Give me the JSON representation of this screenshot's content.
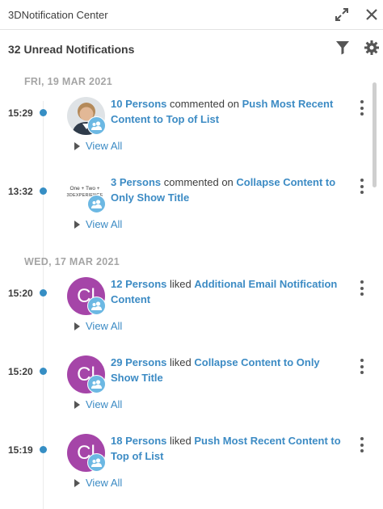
{
  "header": {
    "title": "3DNotification Center",
    "expand_icon": "expand-icon",
    "close_icon": "close-icon"
  },
  "subheader": {
    "unread_label": "32 Unread Notifications",
    "filter_icon": "filter-icon",
    "settings_icon": "gear-icon"
  },
  "colors": {
    "accent": "#3c8bc4",
    "avatar_purple": "#a545a8",
    "badge_blue": "#6cb8e3",
    "date_gray": "#a5a5a5"
  },
  "groups": [
    {
      "date": "FRI, 19 MAR 2021",
      "items": [
        {
          "time": "15:29",
          "avatar_type": "photo",
          "actor": "10 Persons",
          "verb": "commented on",
          "target": "Push Most Recent Content to Top of List",
          "view_all": "View All"
        },
        {
          "time": "13:32",
          "avatar_type": "logo",
          "logo_line1": "One + Two +",
          "logo_line2": "3DEXPERIENCE",
          "actor": "3 Persons",
          "verb": "commented on",
          "target": "Collapse Content to Only Show Title",
          "view_all": "View All"
        }
      ]
    },
    {
      "date": "WED, 17 MAR 2021",
      "items": [
        {
          "time": "15:20",
          "avatar_type": "initials",
          "initials": "Cl",
          "actor": "12 Persons",
          "verb": "liked",
          "target": "Additional Email Notification Content",
          "view_all": "View All"
        },
        {
          "time": "15:20",
          "avatar_type": "initials",
          "initials": "Cl",
          "actor": "29 Persons",
          "verb": "liked",
          "target": "Collapse Content to Only Show Title",
          "view_all": "View All"
        },
        {
          "time": "15:19",
          "avatar_type": "initials",
          "initials": "Cl",
          "actor": "18 Persons",
          "verb": "liked",
          "target": "Push Most Recent Content to Top of List",
          "view_all": "View All"
        }
      ]
    }
  ]
}
